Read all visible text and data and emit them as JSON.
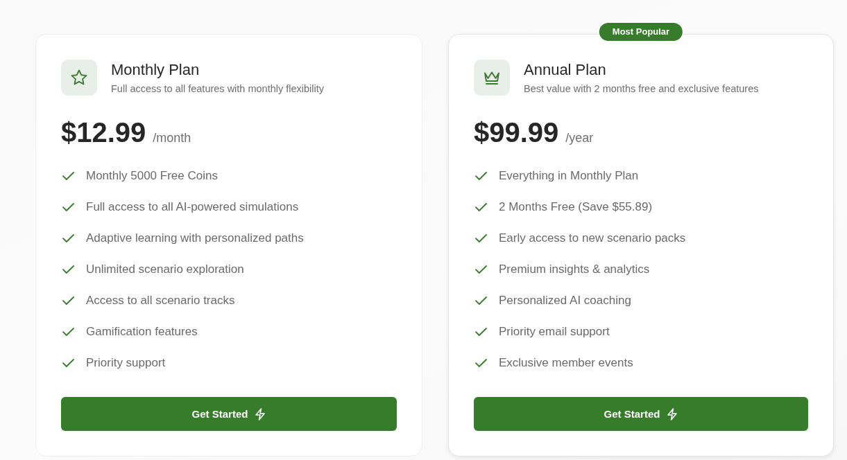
{
  "plans": [
    {
      "kind": "standard",
      "name": "Monthly Plan",
      "description": "Full access to all features with monthly flexibility",
      "price": "$12.99",
      "period": "/month",
      "features": [
        "Monthly 5000 Free Coins",
        "Full access to all AI-powered simulations",
        "Adaptive learning with personalized paths",
        "Unlimited scenario exploration",
        "Access to all scenario tracks",
        "Gamification features",
        "Priority support"
      ],
      "button": "Get Started"
    },
    {
      "kind": "featured",
      "badge": "Most Popular",
      "name": "Annual Plan",
      "description": "Best value with 2 months free and exclusive features",
      "price": "$99.99",
      "period": "/year",
      "features": [
        "Everything in Monthly Plan",
        "2 Months Free (Save $55.89)",
        "Early access to new scenario packs",
        "Premium insights & analytics",
        "Personalized AI coaching",
        "Priority email support",
        "Exclusive member events"
      ],
      "button": "Get Started"
    }
  ]
}
